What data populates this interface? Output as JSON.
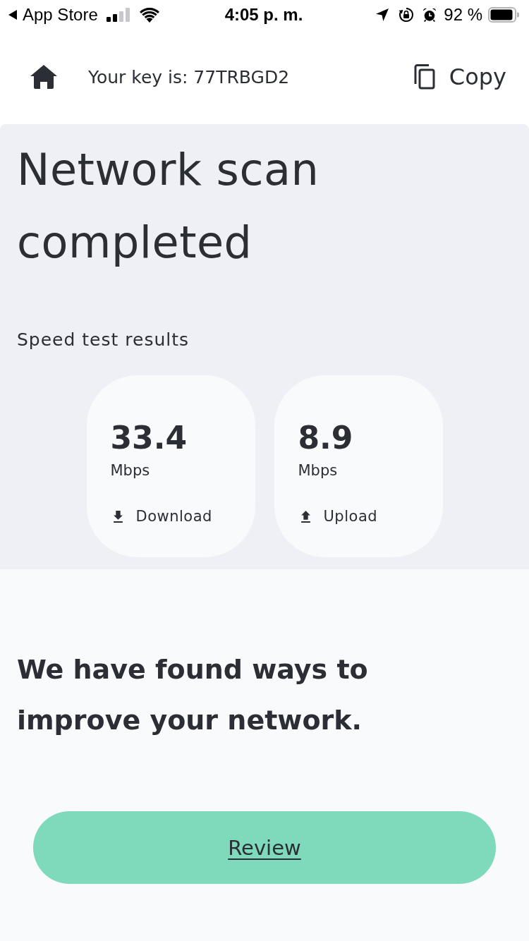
{
  "status_bar": {
    "back_label": "App Store",
    "time": "4:05 p. m.",
    "battery": "92 %"
  },
  "header": {
    "key_text": "Your key is: 77TRBGD2",
    "copy_label": "Copy"
  },
  "scan": {
    "title": "Network scan completed",
    "subtitle": "Speed test results",
    "results": [
      {
        "kind": "download",
        "value": "33.4",
        "unit": "Mbps",
        "label": "Download"
      },
      {
        "kind": "upload",
        "value": "8.9",
        "unit": "Mbps",
        "label": "Upload"
      }
    ]
  },
  "improve": {
    "message": "We have found ways to improve your network.",
    "button": "Review"
  }
}
